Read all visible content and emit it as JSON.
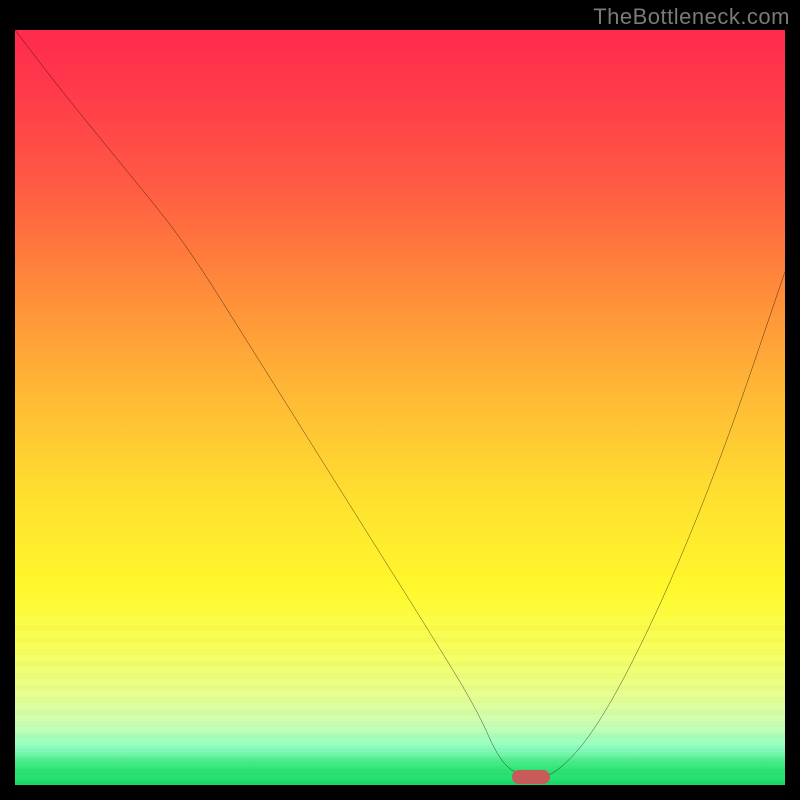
{
  "watermark": "TheBottleneck.com",
  "marker": {
    "x_pct": 67,
    "y_pct": 99
  },
  "colors": {
    "curve": "#000000",
    "marker": "#c85a5a",
    "frame": "#000000"
  },
  "chart_data": {
    "type": "line",
    "title": "",
    "xlabel": "",
    "ylabel": "",
    "xlim": [
      0,
      100
    ],
    "ylim": [
      0,
      100
    ],
    "series": [
      {
        "name": "bottleneck-curve",
        "x": [
          0,
          6,
          14,
          22,
          30,
          38,
          46,
          54,
          60,
          63,
          66,
          70,
          76,
          84,
          92,
          100
        ],
        "y": [
          100,
          92,
          82,
          72,
          59,
          46,
          33,
          20,
          10,
          3,
          1,
          1,
          8,
          24,
          44,
          68
        ]
      }
    ],
    "annotations": [
      {
        "type": "marker",
        "x": 67,
        "y": 1,
        "label": "optimal-point"
      }
    ],
    "background_gradient": {
      "top": "#ff2a4d",
      "mid": "#ffe02f",
      "bottom": "#18d968"
    }
  }
}
